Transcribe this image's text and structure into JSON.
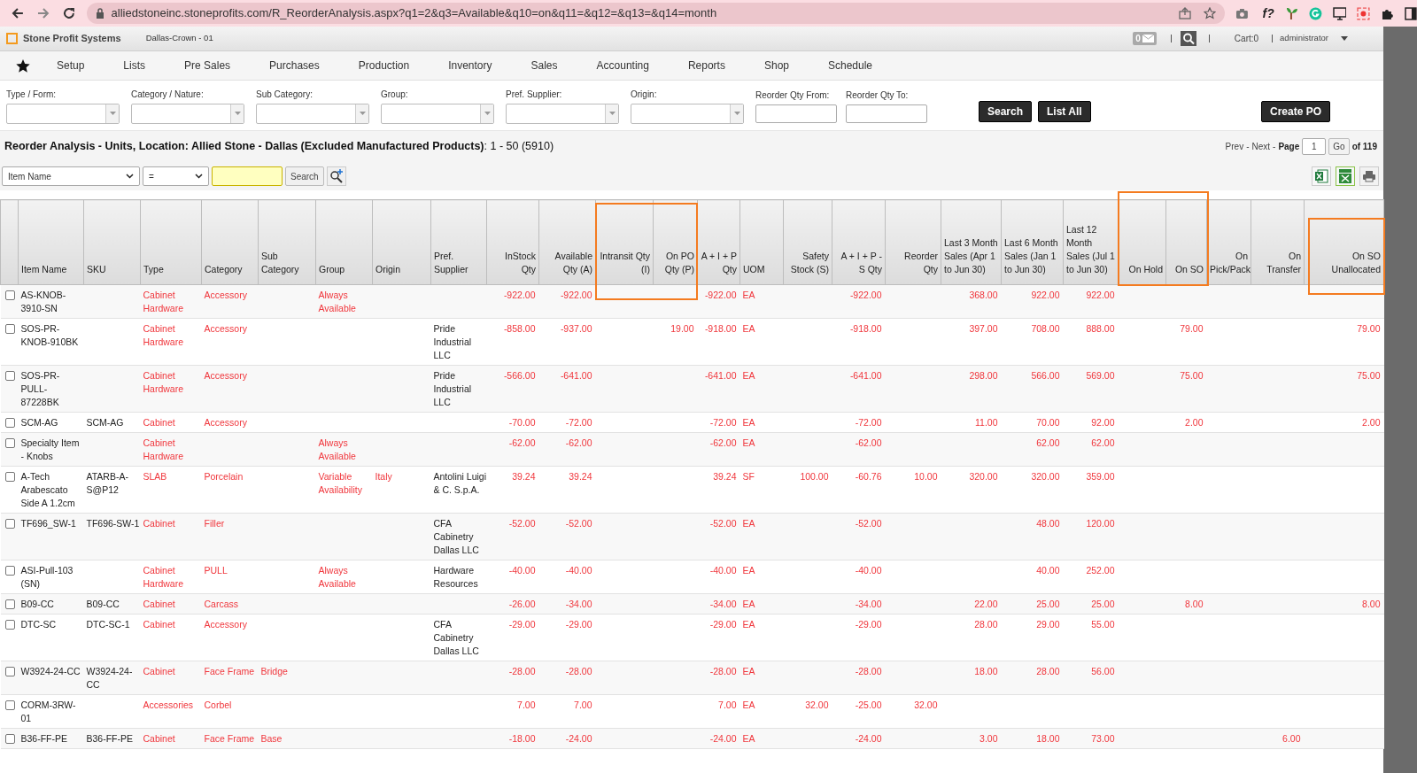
{
  "browser": {
    "url": "alliedstoneinc.stoneprofits.com/R_ReorderAnalysis.aspx?q1=2&q3=Available&q10=on&q11=&q12=&q13=&q14=month",
    "extension_label": "f?"
  },
  "app": {
    "brand": "Stone Profit Systems",
    "location": "Dallas-Crown - 01",
    "messages": "0",
    "cart": "Cart:0",
    "user": "administrator"
  },
  "nav": [
    "Setup",
    "Lists",
    "Pre Sales",
    "Purchases",
    "Production",
    "Inventory",
    "Sales",
    "Accounting",
    "Reports",
    "Shop",
    "Schedule"
  ],
  "filters": [
    {
      "label": "Type / Form:",
      "kind": "select"
    },
    {
      "label": "Category / Nature:",
      "kind": "select"
    },
    {
      "label": "Sub Category:",
      "kind": "select"
    },
    {
      "label": "Group:",
      "kind": "select"
    },
    {
      "label": "Pref. Supplier:",
      "kind": "select"
    },
    {
      "label": "Origin:",
      "kind": "select"
    },
    {
      "label": "Reorder Qty From:",
      "kind": "input"
    },
    {
      "label": "Reorder Qty To:",
      "kind": "input"
    }
  ],
  "filter_buttons": [
    "Search",
    "List All"
  ],
  "create_button": "Create PO",
  "report_title": "**Reorder Analysis - Units, Location: Allied Stone - Dallas (Excluded Manufactured Products)**: 1 - 50 (5910)",
  "pager": {
    "prev": "Prev",
    "separator_1": "-",
    "next": "Next",
    "separator_2": "-",
    "page_label": "Page",
    "page": "1",
    "go": "Go",
    "total": "of 119"
  },
  "quick_search": {
    "field": "Item Name",
    "operator": "=",
    "search": "Search"
  },
  "columns": [
    {
      "label": "Item Name",
      "kind": "text"
    },
    {
      "label": "SKU",
      "kind": "text"
    },
    {
      "label": "Type",
      "kind": "text"
    },
    {
      "label": "Category",
      "kind": "text"
    },
    {
      "label": "Sub Category",
      "kind": "text"
    },
    {
      "label": "Group",
      "kind": "text"
    },
    {
      "label": "Origin",
      "kind": "text"
    },
    {
      "label": "Pref. Supplier",
      "kind": "text"
    },
    {
      "label": "InStock Qty",
      "kind": "number"
    },
    {
      "label": "Available Qty (A)",
      "kind": "number"
    },
    {
      "label": "Intransit Qty (I)",
      "kind": "number"
    },
    {
      "label": "On PO Qty (P)",
      "kind": "number"
    },
    {
      "label": "A + I + P Qty",
      "kind": "number"
    },
    {
      "label": "UOM",
      "kind": "text"
    },
    {
      "label": "Safety Stock (S)",
      "kind": "number"
    },
    {
      "label": "A + I + P - S Qty",
      "kind": "number"
    },
    {
      "label": "Reorder Qty",
      "kind": "number"
    },
    {
      "label": "Last 3 Month Sales (Apr 1 to Jun 30)",
      "kind": "sales"
    },
    {
      "label": "Last 6 Month Sales (Jan 1 to Jun 30)",
      "kind": "sales"
    },
    {
      "label": "Last 12 Month Sales (Jul 1 to Jun 30)",
      "kind": "sales"
    },
    {
      "label": "On Hold",
      "kind": "number"
    },
    {
      "label": "On SO",
      "kind": "number"
    },
    {
      "label": "On Pick/Pack",
      "kind": "number"
    },
    {
      "label": "On Transfer",
      "kind": "number"
    },
    {
      "label": "On SO Unallocated",
      "kind": "number"
    }
  ],
  "rows": [
    {
      "checked": false,
      "cells": [
        "AS-KNOB-3910-SN",
        null,
        "Cabinet Hardware",
        "Accessory",
        null,
        "Always Available",
        null,
        null,
        "-922.00",
        "-922.00",
        null,
        null,
        "-922.00",
        "EA",
        null,
        "-922.00",
        null,
        "368.00",
        "922.00",
        "922.00",
        null,
        null,
        null,
        null,
        null
      ]
    },
    {
      "checked": false,
      "cells": [
        "SOS-PR-KNOB-910BK",
        null,
        "Cabinet Hardware",
        "Accessory",
        null,
        null,
        null,
        "Pride Industrial LLC",
        "-858.00",
        "-937.00",
        null,
        "19.00",
        "-918.00",
        "EA",
        null,
        "-918.00",
        null,
        "397.00",
        "708.00",
        "888.00",
        null,
        "79.00",
        null,
        null,
        "79.00"
      ]
    },
    {
      "checked": false,
      "cells": [
        "SOS-PR-PULL-87228BK",
        null,
        "Cabinet Hardware",
        "Accessory",
        null,
        null,
        null,
        "Pride Industrial LLC",
        "-566.00",
        "-641.00",
        null,
        null,
        "-641.00",
        "EA",
        null,
        "-641.00",
        null,
        "298.00",
        "566.00",
        "569.00",
        null,
        "75.00",
        null,
        null,
        "75.00"
      ]
    },
    {
      "checked": false,
      "cells": [
        "SCM-AG",
        "SCM-AG",
        "Cabinet",
        "Accessory",
        null,
        null,
        null,
        null,
        "-70.00",
        "-72.00",
        null,
        null,
        "-72.00",
        "EA",
        null,
        "-72.00",
        null,
        "11.00",
        "70.00",
        "92.00",
        null,
        "2.00",
        null,
        null,
        "2.00"
      ]
    },
    {
      "checked": false,
      "cells": [
        "Specialty Item - Knobs",
        null,
        "Cabinet Hardware",
        null,
        null,
        "Always Available",
        null,
        null,
        "-62.00",
        "-62.00",
        null,
        null,
        "-62.00",
        "EA",
        null,
        "-62.00",
        null,
        null,
        "62.00",
        "62.00",
        null,
        null,
        null,
        null,
        null
      ]
    },
    {
      "checked": false,
      "cells": [
        "A-Tech Arabescato Side A 1.2cm",
        "ATARB-A-S@P12",
        "SLAB",
        "Porcelain",
        null,
        "Variable Availability",
        "Italy",
        "Antolini Luigi & C. S.p.A.",
        "39.24",
        "39.24",
        null,
        null,
        "39.24",
        "SF",
        "100.00",
        "-60.76",
        "10.00",
        "320.00",
        "320.00",
        "359.00",
        null,
        null,
        null,
        null,
        null
      ]
    },
    {
      "checked": false,
      "cells": [
        "TF696_SW-1",
        "TF696-SW-1",
        "Cabinet",
        "Filler",
        null,
        null,
        null,
        "CFA Cabinetry Dallas LLC",
        "-52.00",
        "-52.00",
        null,
        null,
        "-52.00",
        "EA",
        null,
        "-52.00",
        null,
        null,
        "48.00",
        "120.00",
        null,
        null,
        null,
        null,
        null
      ]
    },
    {
      "checked": false,
      "cells": [
        "ASI-Pull-103 (SN)",
        null,
        "Cabinet Hardware",
        "PULL",
        null,
        "Always Available",
        null,
        "Hardware Resources",
        "-40.00",
        "-40.00",
        null,
        null,
        "-40.00",
        "EA",
        null,
        "-40.00",
        null,
        null,
        "40.00",
        "252.00",
        null,
        null,
        null,
        null,
        null
      ]
    },
    {
      "checked": false,
      "cells": [
        "B09-CC",
        "B09-CC",
        "Cabinet",
        "Carcass",
        null,
        null,
        null,
        null,
        "-26.00",
        "-34.00",
        null,
        null,
        "-34.00",
        "EA",
        null,
        "-34.00",
        null,
        "22.00",
        "25.00",
        "25.00",
        null,
        "8.00",
        null,
        null,
        "8.00"
      ]
    },
    {
      "checked": false,
      "cells": [
        "DTC-SC",
        "DTC-SC-1",
        "Cabinet",
        "Accessory",
        null,
        null,
        null,
        "CFA Cabinetry Dallas LLC",
        "-29.00",
        "-29.00",
        null,
        null,
        "-29.00",
        "EA",
        null,
        "-29.00",
        null,
        "28.00",
        "29.00",
        "55.00",
        null,
        null,
        null,
        null,
        null
      ]
    },
    {
      "checked": false,
      "cells": [
        "W3924-24-CC",
        "W3924-24-CC",
        "Cabinet",
        "Face Frame",
        "Bridge",
        null,
        null,
        null,
        "-28.00",
        "-28.00",
        null,
        null,
        "-28.00",
        "EA",
        null,
        "-28.00",
        null,
        "18.00",
        "28.00",
        "56.00",
        null,
        null,
        null,
        null,
        null
      ]
    },
    {
      "checked": false,
      "cells": [
        "CORM-3RW-01",
        null,
        "Accessories",
        "Corbel",
        null,
        null,
        null,
        null,
        "7.00",
        "7.00",
        null,
        null,
        "7.00",
        "EA",
        "32.00",
        "-25.00",
        "32.00",
        null,
        null,
        null,
        null,
        null,
        null,
        null,
        null
      ]
    },
    {
      "checked": false,
      "cells": [
        "B36-FF-PE",
        "B36-FF-PE",
        "Cabinet",
        "Face Frame",
        "Base",
        null,
        null,
        null,
        "-18.00",
        "-24.00",
        null,
        null,
        "-24.00",
        "EA",
        null,
        "-24.00",
        null,
        "3.00",
        "18.00",
        "73.00",
        null,
        null,
        null,
        "6.00",
        null
      ]
    }
  ]
}
